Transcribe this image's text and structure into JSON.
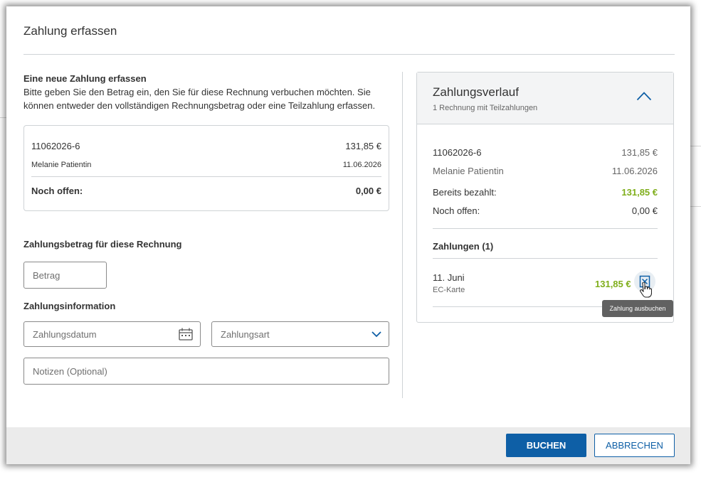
{
  "dialog": {
    "title": "Zahlung erfassen"
  },
  "new_payment": {
    "heading": "Eine neue Zahlung erfassen",
    "description": "Bitte geben Sie den Betrag ein, den Sie für diese Rechnung verbuchen möchten. Sie können entweder den vollständigen Rechnungsbetrag oder eine Teilzahlung erfassen."
  },
  "invoice": {
    "number": "11062026-6",
    "amount": "131,85 €",
    "patient": "Melanie Patientin",
    "date": "11.06.2026",
    "open_label": "Noch offen:",
    "open_value": "0,00 €"
  },
  "amount_section": {
    "label": "Zahlungsbetrag für diese Rechnung",
    "placeholder": "Betrag"
  },
  "info_section": {
    "label": "Zahlungsinformation",
    "date_placeholder": "Zahlungsdatum",
    "type_placeholder": "Zahlungsart",
    "notes_placeholder": "Notizen (Optional)"
  },
  "history": {
    "title": "Zahlungsverlauf",
    "subtitle": "1 Rechnung mit Teilzahlungen",
    "invoice_number": "11062026-6",
    "invoice_amount": "131,85 €",
    "patient": "Melanie Patientin",
    "date": "11.06.2026",
    "paid_label": "Bereits bezahlt:",
    "paid_value": "131,85 €",
    "open_label": "Noch offen:",
    "open_value": "0,00 €",
    "payments_heading": "Zahlungen (1)",
    "payments": [
      {
        "date": "11. Juni",
        "method": "EC-Karte",
        "amount": "131,85 €"
      }
    ]
  },
  "tooltip": {
    "text": "Zahlung ausbuchen"
  },
  "footer": {
    "book_label": "BUCHEN",
    "cancel_label": "ABBRECHEN"
  },
  "colors": {
    "primary": "#0e5fa6",
    "paid_green": "#7fae1b",
    "border": "#cfd3d6",
    "footer_bg": "#ebebeb",
    "tooltip_bg": "#616161"
  },
  "icons": {
    "date_field": "calendar-icon",
    "type_field": "chevron-down-icon",
    "history_toggle": "chevron-up-icon",
    "payment_action": "cancel-payment-icon",
    "pointer": "hand-pointer-icon"
  }
}
